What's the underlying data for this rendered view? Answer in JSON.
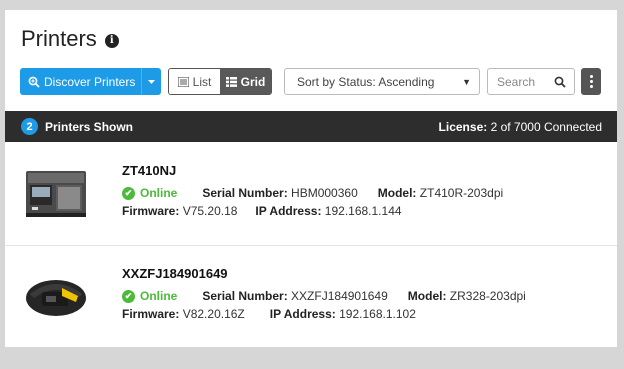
{
  "header": {
    "title": "Printers"
  },
  "toolbar": {
    "discover_label": "Discover Printers",
    "list_label": "List",
    "grid_label": "Grid",
    "sort_value": "Sort by Status: Ascending",
    "search_placeholder": "Search"
  },
  "summary": {
    "count": "2",
    "shown_label": "Printers Shown",
    "license_label": "License:",
    "license_value": "2 of 7000 Connected"
  },
  "printers": [
    {
      "name": "ZT410NJ",
      "status": "Online",
      "serial_label": "Serial Number:",
      "serial": "HBM000360",
      "model_label": "Model:",
      "model": "ZT410R-203dpi",
      "firmware_label": "Firmware:",
      "firmware": "V75.20.18",
      "ip_label": "IP Address:",
      "ip": "192.168.1.144"
    },
    {
      "name": "XXZFJ184901649",
      "status": "Online",
      "serial_label": "Serial Number:",
      "serial": "XXZFJ184901649",
      "model_label": "Model:",
      "model": "ZR328-203dpi",
      "firmware_label": "Firmware:",
      "firmware": "V82.20.16Z",
      "ip_label": "IP Address:",
      "ip": "192.168.1.102"
    }
  ],
  "colors": {
    "accent": "#1e9be6",
    "online": "#4cbb3a",
    "bar": "#2d2d2d"
  }
}
